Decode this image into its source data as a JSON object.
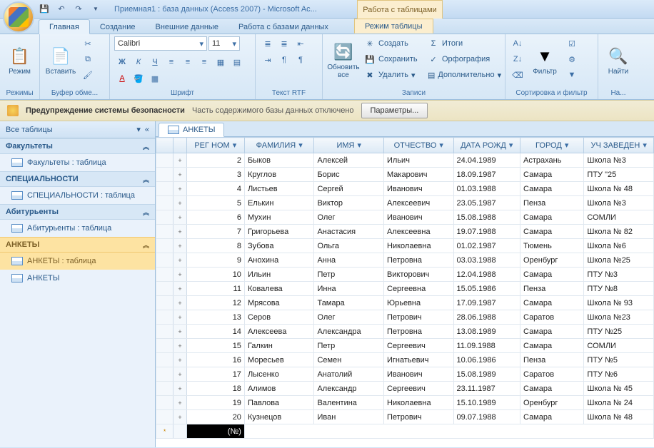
{
  "title": "Приемная1 : база данных (Access 2007) - Microsoft Ac...",
  "contextTabGroup": "Работа с таблицами",
  "tabs": {
    "home": "Главная",
    "create": "Создание",
    "external": "Внешние данные",
    "dbwork": "Работа с базами данных",
    "mode": "Режим таблицы"
  },
  "ribbon": {
    "font_name": "Calibri",
    "font_size": "11",
    "groups": {
      "modes": "Режимы",
      "clipboard": "Буфер обме...",
      "font": "Шрифт",
      "rtf": "Текст RTF",
      "records": "Записи",
      "sort": "Сортировка и фильтр",
      "find": "На..."
    },
    "btns": {
      "mode": "Режим",
      "paste": "Вставить",
      "refresh": "Обновить\nвсе",
      "filter": "Фильтр",
      "find": "Найти"
    },
    "rec": {
      "new": "Создать",
      "save": "Сохранить",
      "delete": "Удалить",
      "totals": "Итоги",
      "spell": "Орфография",
      "more": "Дополнительно"
    }
  },
  "warn": {
    "title": "Предупреждение системы безопасности",
    "msg": "Часть содержимого базы данных отключено",
    "btn": "Параметры..."
  },
  "nav": {
    "header": "Все таблицы",
    "groups": [
      {
        "name": "Факультеты",
        "items": [
          "Факультеты : таблица"
        ],
        "sel": false
      },
      {
        "name": "СПЕЦИАЛЬНОСТИ",
        "items": [
          "СПЕЦИАЛЬНОСТИ : таблица"
        ],
        "sel": false
      },
      {
        "name": "Абитурьенты",
        "items": [
          "Абитурьенты : таблица"
        ],
        "sel": false
      },
      {
        "name": "АНКЕТЫ",
        "items": [
          "АНКЕТЫ : таблица",
          "АНКЕТЫ"
        ],
        "sel": true
      }
    ]
  },
  "sheet": {
    "tab": "АНКЕТЫ",
    "columns": [
      "РЕГ НОМ",
      "ФАМИЛИЯ",
      "ИМЯ",
      "ОТЧЕСТВО",
      "ДАТА РОЖД",
      "ГОРОД",
      "УЧ ЗАВЕДЕН"
    ],
    "newrow": "(№)",
    "rows": [
      [
        2,
        "Быков",
        "Алексей",
        "Ильич",
        "24.04.1989",
        "Астрахань",
        "Школа №3"
      ],
      [
        3,
        "Круглов",
        "Борис",
        "Макарович",
        "18.09.1987",
        "Самара",
        "ПТУ \"25"
      ],
      [
        4,
        "Листьев",
        "Сергей",
        "Иванович",
        "01.03.1988",
        "Самара",
        "Школа № 48"
      ],
      [
        5,
        "Елькин",
        "Виктор",
        "Алексеевич",
        "23.05.1987",
        "Пенза",
        "Школа №3"
      ],
      [
        6,
        "Мухин",
        "Олег",
        "Иванович",
        "15.08.1988",
        "Самара",
        "СОМЛИ"
      ],
      [
        7,
        "Григорьева",
        "Анастасия",
        "Алексеевна",
        "19.07.1988",
        "Самара",
        "Школа № 82"
      ],
      [
        8,
        "Зубова",
        "Ольга",
        "Николаевна",
        "01.02.1987",
        "Тюмень",
        "Школа №6"
      ],
      [
        9,
        "Анохина",
        "Анна",
        "Петровна",
        "03.03.1988",
        "Оренбург",
        "Школа №25"
      ],
      [
        10,
        "Ильин",
        "Петр",
        "Викторович",
        "12.04.1988",
        "Самара",
        "ПТУ №3"
      ],
      [
        11,
        "Ковалева",
        "Инна",
        "Сергеевна",
        "15.05.1986",
        "Пенза",
        "ПТУ №8"
      ],
      [
        12,
        "Мрясова",
        "Тамара",
        "Юрьевна",
        "17.09.1987",
        "Самара",
        "Школа № 93"
      ],
      [
        13,
        "Серов",
        "Олег",
        "Петрович",
        "28.06.1988",
        "Саратов",
        "Школа №23"
      ],
      [
        14,
        "Алексеева",
        "Александра",
        "Петровна",
        "13.08.1989",
        "Самара",
        "ПТУ №25"
      ],
      [
        15,
        "Галкин",
        "Петр",
        "Сергеевич",
        "11.09.1988",
        "Самара",
        "СОМЛИ"
      ],
      [
        16,
        "Моресьев",
        "Семен",
        "Игнатьевич",
        "10.06.1986",
        "Пенза",
        "ПТУ №5"
      ],
      [
        17,
        "Лысенко",
        "Анатолий",
        "Иванович",
        "15.08.1989",
        "Саратов",
        "ПТУ №6"
      ],
      [
        18,
        "Алимов",
        "Александр",
        "Сергеевич",
        "23.11.1987",
        "Самара",
        "Школа № 45"
      ],
      [
        19,
        "Павлова",
        "Валентина",
        "Николаевна",
        "15.10.1989",
        "Оренбург",
        "Школа № 24"
      ],
      [
        20,
        "Кузнецов",
        "Иван",
        "Петрович",
        "09.07.1988",
        "Самара",
        "Школа № 48"
      ]
    ]
  }
}
